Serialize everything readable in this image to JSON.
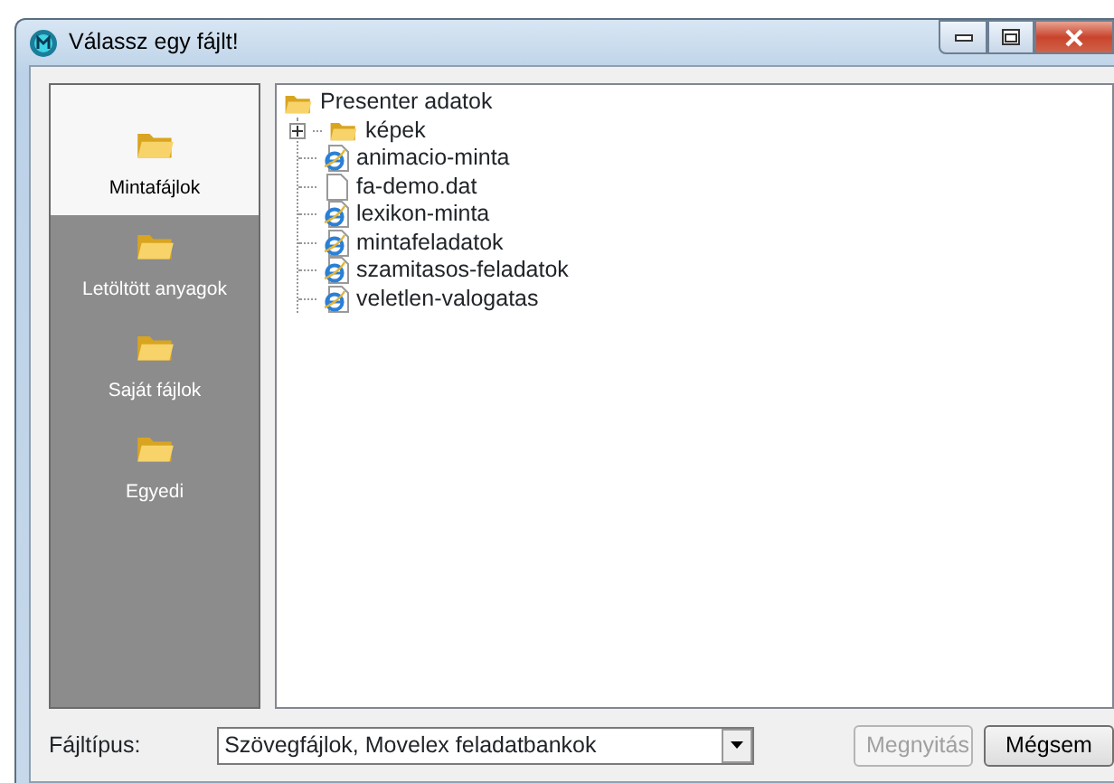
{
  "window": {
    "title": "Válassz egy fájlt!"
  },
  "sidebar": {
    "items": [
      {
        "label": "Mintafájlok",
        "selected": true
      },
      {
        "label": "Letöltött anyagok",
        "selected": false
      },
      {
        "label": "Saját fájlok",
        "selected": false
      },
      {
        "label": "Egyedi",
        "selected": false
      }
    ]
  },
  "tree": {
    "label": "Presenter adatok",
    "children": [
      {
        "label": "képek",
        "kind": "folder",
        "expanded": false
      },
      {
        "label": "animacio-minta",
        "kind": "web"
      },
      {
        "label": "fa-demo.dat",
        "kind": "file"
      },
      {
        "label": "lexikon-minta",
        "kind": "web"
      },
      {
        "label": "mintafeladatok",
        "kind": "web"
      },
      {
        "label": "szamitasos-feladatok",
        "kind": "web"
      },
      {
        "label": "veletlen-valogatas",
        "kind": "web"
      }
    ]
  },
  "file_type": {
    "label": "Fájltípus:",
    "value": "Szövegfájlok, Movelex feladatbankok"
  },
  "buttons": [
    {
      "label": "Megnyitás",
      "disabled": true
    },
    {
      "label": "Mégsem",
      "disabled": false
    }
  ]
}
